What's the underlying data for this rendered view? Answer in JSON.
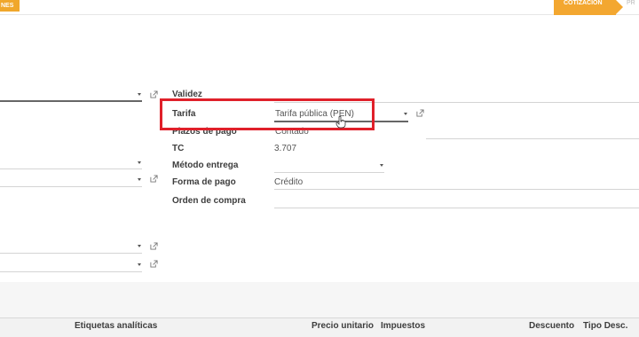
{
  "topbar": {
    "action_button_label": "NES",
    "status_active": "COTIZACIÓN",
    "status_next": "PR"
  },
  "form": {
    "validez_label": "Validez",
    "tarifa_label": "Tarifa",
    "tarifa_value": "Tarifa pública (PEN)",
    "plazos_label": "Plazos de pago",
    "plazos_value": "Contado",
    "tc_label": "TC",
    "tc_value": "3.707",
    "metodo_label": "Método entrega",
    "metodo_value": "",
    "forma_label": "Forma de pago",
    "forma_value": "Crédito",
    "orden_label": "Orden de compra",
    "orden_value": ""
  },
  "table": {
    "headers": [
      "Etiquetas analíticas",
      "Precio unitario",
      "Impuestos",
      "Descuento",
      "Tipo Desc."
    ]
  },
  "colors": {
    "accent": "#f3a730",
    "highlight": "#e0202a"
  }
}
